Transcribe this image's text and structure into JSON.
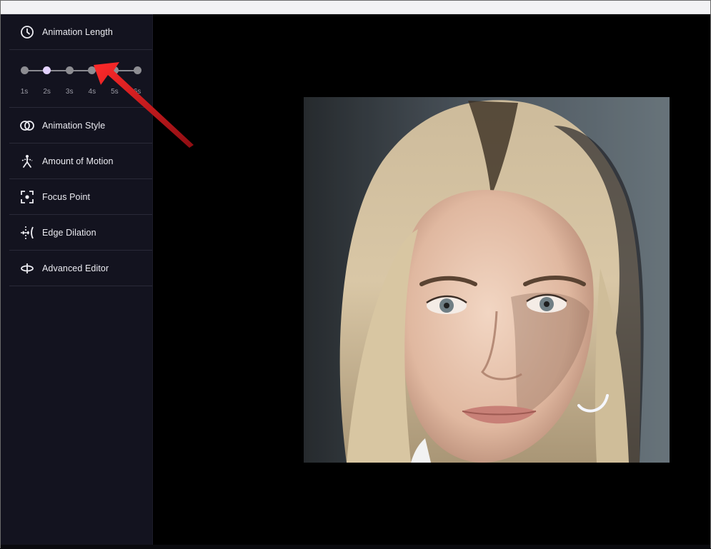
{
  "sidebar": {
    "animation_length": {
      "label": "Animation Length",
      "icon": "clock-icon",
      "slider": {
        "options": [
          "1s",
          "2s",
          "3s",
          "4s",
          "5s",
          "6s"
        ],
        "selected_index": 1,
        "selected": "2s"
      }
    },
    "items": [
      {
        "label": "Animation Style",
        "icon": "interlocked-rings-icon"
      },
      {
        "label": "Amount of Motion",
        "icon": "motion-figure-icon"
      },
      {
        "label": "Focus Point",
        "icon": "focus-frame-icon"
      },
      {
        "label": "Edge Dilation",
        "icon": "edge-dilation-icon"
      },
      {
        "label": "Advanced Editor",
        "icon": "orbit-icon"
      }
    ]
  },
  "preview": {
    "subject": "portrait-photo"
  },
  "annotation": {
    "arrow_color": "#d81b24"
  },
  "colors": {
    "sidebar_bg": "#13131f",
    "canvas_bg": "#000000",
    "selected_dot": "#e3d2ff",
    "dot": "#8d8d92"
  }
}
